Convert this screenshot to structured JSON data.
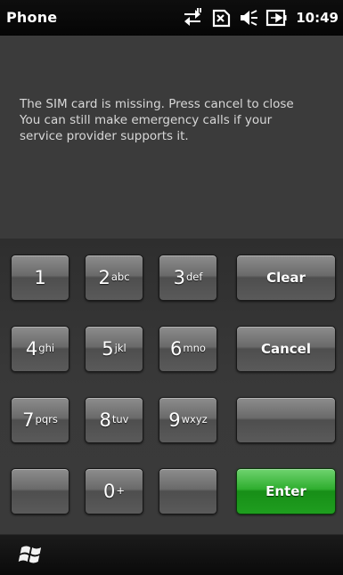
{
  "status_bar": {
    "app_title": "Phone",
    "time": "10:49",
    "icons": [
      "data-transfer-icon",
      "no-sim-icon",
      "volume-icon",
      "battery-charging-icon"
    ]
  },
  "message": {
    "lines": [
      "The SIM card is missing. Press cancel to close",
      "You can still make emergency calls if your",
      "service provider supports it."
    ]
  },
  "keypad": {
    "keys": [
      {
        "digit": "1",
        "letters": ""
      },
      {
        "digit": "2",
        "letters": "abc"
      },
      {
        "digit": "3",
        "letters": "def"
      },
      {
        "digit": "4",
        "letters": "ghi"
      },
      {
        "digit": "5",
        "letters": "jkl"
      },
      {
        "digit": "6",
        "letters": "mno"
      },
      {
        "digit": "7",
        "letters": "pqrs"
      },
      {
        "digit": "8",
        "letters": "tuv"
      },
      {
        "digit": "9",
        "letters": "wxyz"
      },
      {
        "digit": "0",
        "letters": "+"
      }
    ],
    "clear_label": "Clear",
    "cancel_label": "Cancel",
    "enter_label": "Enter"
  },
  "taskbar": {
    "start_icon": "windows-flag-icon"
  },
  "colors": {
    "background": "#3b3b3b",
    "message_text": "#d8d8d8",
    "enter_green": "#2fae2f"
  }
}
